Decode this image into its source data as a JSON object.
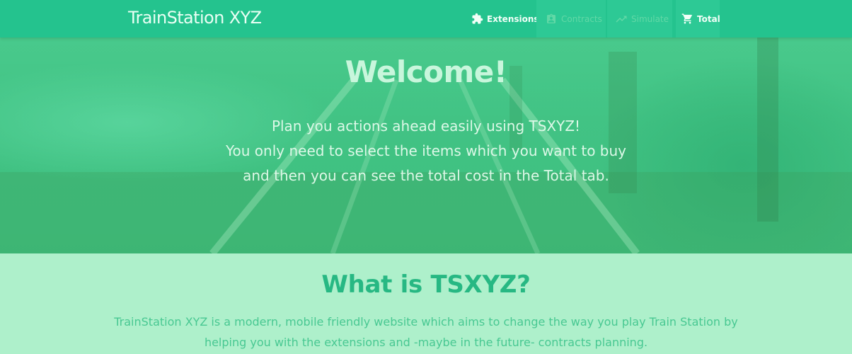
{
  "navbar": {
    "brand": "TrainStation XYZ",
    "items": [
      {
        "label": "Extensions",
        "icon": "puzzle-icon",
        "state": "active"
      },
      {
        "label": "Contracts",
        "icon": "contract-icon",
        "state": "disabled"
      },
      {
        "label": "Simulate",
        "icon": "trending-up-icon",
        "state": "disabled"
      },
      {
        "label": "Total",
        "icon": "cart-icon",
        "state": "active"
      }
    ]
  },
  "hero": {
    "title": "Welcome!",
    "lines": [
      "Plan you actions ahead easily using TSXYZ!",
      "You only need to select the items which you want to buy",
      "and then you can see the total cost in the Total tab."
    ]
  },
  "about": {
    "title": "What is TSXYZ?",
    "lines": [
      "TrainStation XYZ is a modern, mobile friendly website which aims to change the way you play Train Station by",
      "helping you with the extensions and -maybe in the future- contracts planning."
    ]
  },
  "colors": {
    "navbar_bg": "#24c38e",
    "hero_overlay": "#29c58c",
    "about_bg": "#aef0cb",
    "accent_text": "#27b883"
  }
}
